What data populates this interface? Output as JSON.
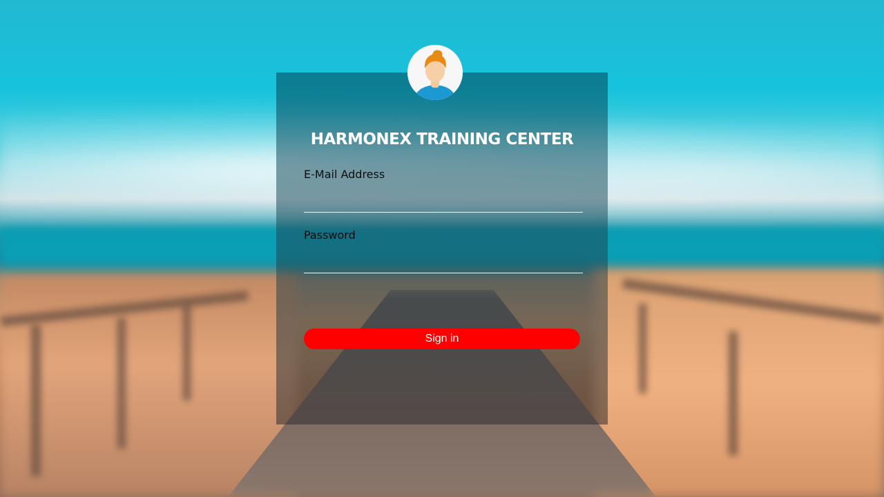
{
  "login_card": {
    "title": "HARMONEX TRAINING CENTER",
    "email": {
      "label": "E-Mail Address",
      "value": "",
      "placeholder": ""
    },
    "password": {
      "label": "Password",
      "value": "",
      "placeholder": ""
    },
    "submit_label": "Sign in"
  },
  "icons": {
    "avatar": "user-avatar-icon"
  },
  "colors": {
    "submit_button": "#ff0000",
    "title_text": "#ffffff",
    "label_text": "#0d0d0d",
    "field_underline": "#ffffff"
  }
}
